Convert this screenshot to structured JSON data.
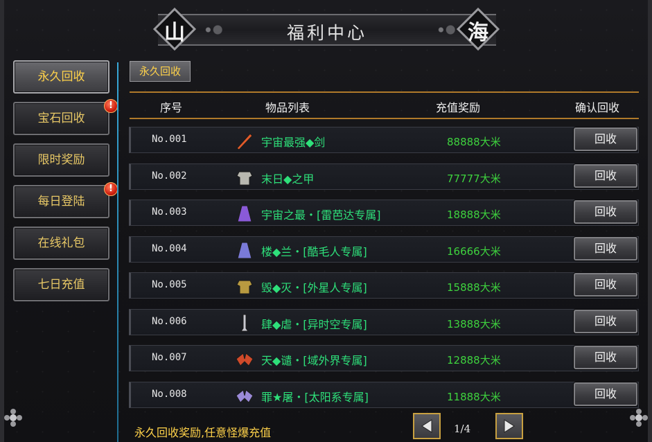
{
  "title": {
    "text": "福利中心",
    "left_emblem": "山",
    "right_emblem": "海"
  },
  "sidebar": {
    "items": [
      {
        "label": "永久回收",
        "active": true,
        "badge": ""
      },
      {
        "label": "宝石回收",
        "active": false,
        "badge": "!"
      },
      {
        "label": "限时奖励",
        "active": false,
        "badge": ""
      },
      {
        "label": "每日登陆",
        "active": false,
        "badge": "!"
      },
      {
        "label": "在线礼包",
        "active": false,
        "badge": ""
      },
      {
        "label": "七日充值",
        "active": false,
        "badge": ""
      }
    ]
  },
  "tab": {
    "label": "永久回收"
  },
  "table": {
    "headers": {
      "no": "序号",
      "items": "物品列表",
      "reward": "充值奖励",
      "confirm": "确认回收"
    },
    "rows": [
      {
        "no": "No.001",
        "name": "宇宙最强◆剑",
        "reward": "88888大米",
        "button": "回收",
        "icon": "sword-icon",
        "icon_color": "#e05a2a"
      },
      {
        "no": "No.002",
        "name": "末日◆之甲",
        "reward": "77777大米",
        "button": "回收",
        "icon": "armor-icon",
        "icon_color": "#b8b8b0"
      },
      {
        "no": "No.003",
        "name": "宇宙之最・[雷芭达专属]",
        "reward": "18888大米",
        "button": "回收",
        "icon": "robe-icon",
        "icon_color": "#8a5ad8"
      },
      {
        "no": "No.004",
        "name": "楼◆兰・[酷毛人专属]",
        "reward": "16666大米",
        "button": "回收",
        "icon": "robe-icon",
        "icon_color": "#7a7ad8"
      },
      {
        "no": "No.005",
        "name": "毁◆灭・[外星人专属]",
        "reward": "15888大米",
        "button": "回收",
        "icon": "armor-icon",
        "icon_color": "#b89a40"
      },
      {
        "no": "No.006",
        "name": "肆◆虐・[异时空专属]",
        "reward": "13888大米",
        "button": "回收",
        "icon": "blade-icon",
        "icon_color": "#c8c8d0"
      },
      {
        "no": "No.007",
        "name": "天◆谴・[域外界专属]",
        "reward": "12888大米",
        "button": "回收",
        "icon": "wing-icon",
        "icon_color": "#d04a2a"
      },
      {
        "no": "No.008",
        "name": "罪★屠・[太阳系专属]",
        "reward": "11888大米",
        "button": "回收",
        "icon": "wing-icon",
        "icon_color": "#9a8ad8"
      }
    ]
  },
  "footer": {
    "note": "永久回收奖励,任意怪爆充值",
    "page": "1/4",
    "prev_icon": "arrow-left-icon",
    "next_icon": "arrow-right-icon"
  },
  "colors": {
    "accent_gold": "#ffd24a",
    "item_green": "#2ee07a",
    "reward_green": "#3ed23e",
    "divider_blue": "#38a8d8"
  }
}
